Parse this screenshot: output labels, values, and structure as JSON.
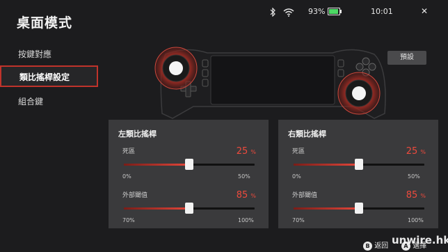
{
  "header": {
    "title": "桌面模式"
  },
  "status_bar": {
    "battery_percent": "93%",
    "time": "10:01",
    "close_symbol": "✕",
    "battery_level": 0.93,
    "icons": [
      "bluetooth-icon",
      "wifi-icon",
      "battery-icon"
    ]
  },
  "sidebar": {
    "items": [
      {
        "label": "按鍵對應"
      },
      {
        "label": "類比搖桿設定",
        "active": true
      },
      {
        "label": "組合鍵"
      }
    ]
  },
  "preset_button": {
    "label": "預設"
  },
  "panels": [
    {
      "title": "左類比搖桿",
      "sliders": [
        {
          "label": "死區",
          "value": "25",
          "unit": "%",
          "level": 0.25,
          "min_label": "0%",
          "max_label": "50%",
          "fill": 0.5
        },
        {
          "label": "外部閾值",
          "value": "85",
          "unit": "%",
          "level": 85,
          "min_label": "70%",
          "max_label": "100%",
          "fill": 0.5
        }
      ]
    },
    {
      "title": "右類比搖桿",
      "sliders": [
        {
          "label": "死區",
          "value": "25",
          "unit": "%",
          "level": 0.25,
          "min_label": "0%",
          "max_label": "50%",
          "fill": 0.5
        },
        {
          "label": "外部閾值",
          "value": "85",
          "unit": "%",
          "level": 85,
          "min_label": "70%",
          "max_label": "100%",
          "fill": 0.5
        }
      ]
    }
  ],
  "footer": {
    "back_key": "B",
    "back_label": "返回",
    "select_key": "A",
    "select_label": "選擇"
  },
  "watermark": "unwire.hk",
  "colors": {
    "accent": "#e4463a",
    "background": "#1c1c1e",
    "panel": "#3a3a3c"
  }
}
